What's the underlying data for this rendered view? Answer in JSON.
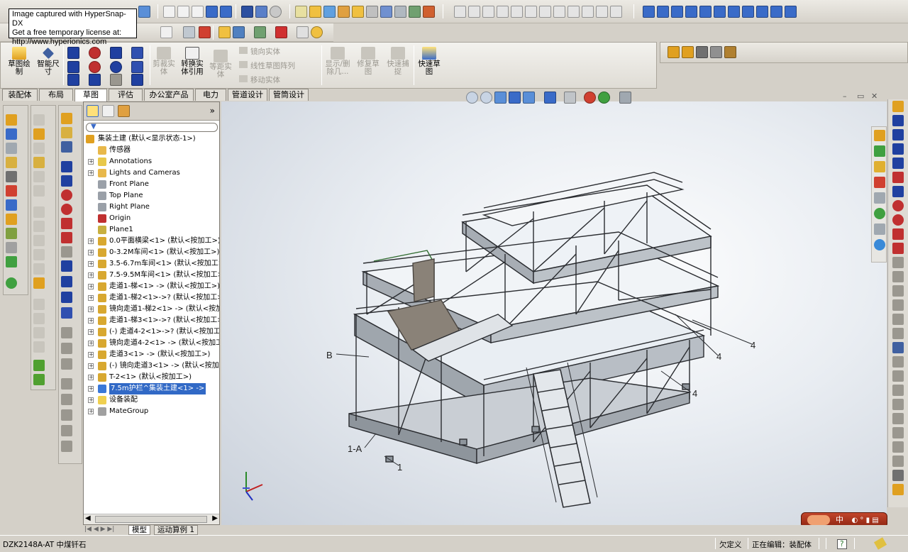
{
  "watermark": {
    "line1": "Image captured with HyperSnap-DX",
    "line2": "Get a free temporary license at:",
    "line3": "http://www.hyperionics.com"
  },
  "command_manager": {
    "sketch_btn": "草图绘制",
    "smart_dim_btn": "智能尺寸",
    "trim_btn": "剪裁实体",
    "convert_btn": "转换实体引用",
    "offset_btn": "等距实体",
    "mirror_entities": "镜向实体",
    "linear_pattern": "线性草图阵列",
    "move_entities": "移动实体",
    "show_delete_btn": "显示/删除几...",
    "repair_btn": "修复草图",
    "quick_snap_btn": "快速捕捉",
    "rapid_sketch_btn": "快速草图"
  },
  "tabs": [
    "装配体",
    "布局",
    "草图",
    "评估",
    "办公室产品",
    "电力",
    "管道设计",
    "管筒设计"
  ],
  "active_tab": "草图",
  "feature_tree": {
    "root": "集装土建 (默认<显示状态-1>)",
    "items": [
      {
        "label": "传感器",
        "expand": false,
        "color": "#e8b84a"
      },
      {
        "label": "Annotations",
        "expand": true,
        "color": "#e8c84a"
      },
      {
        "label": "Lights and Cameras",
        "expand": true,
        "color": "#e8b84a"
      },
      {
        "label": "Front Plane",
        "expand": false,
        "color": "#9aa0a8"
      },
      {
        "label": "Top Plane",
        "expand": false,
        "color": "#9aa0a8"
      },
      {
        "label": "Right Plane",
        "expand": false,
        "color": "#9aa0a8"
      },
      {
        "label": "Origin",
        "expand": false,
        "color": "#c03030"
      },
      {
        "label": "Plane1",
        "expand": false,
        "color": "#c8b040"
      },
      {
        "label": "0.0平面横梁<1> (默认<按加工>)",
        "expand": true,
        "color": "#d8a830"
      },
      {
        "label": "0-3.2M车间<1> (默认<按加工>)",
        "expand": true,
        "color": "#d8a830"
      },
      {
        "label": "3.5-6.7m车间<1> (默认<按加工>)",
        "expand": true,
        "color": "#d8a830"
      },
      {
        "label": "7.5-9.5M车间<1> (默认<按加工>)",
        "expand": true,
        "color": "#d8a830"
      },
      {
        "label": "走道1-梯<1> -> (默认<按加工>)",
        "expand": true,
        "color": "#d8a830"
      },
      {
        "label": "走道1-梯2<1>->? (默认<按加工>)",
        "expand": true,
        "color": "#d8a830"
      },
      {
        "label": "镜向走道1-梯2<1> -> (默认<按加工>)",
        "expand": true,
        "color": "#d8a830"
      },
      {
        "label": "走道1-梯3<1>->? (默认<按加工>)",
        "expand": true,
        "color": "#d8a830"
      },
      {
        "label": "(-) 走道4-2<1>->? (默认<按加工>)",
        "expand": true,
        "color": "#d8a830"
      },
      {
        "label": "镜向走道4-2<1> -> (默认<按加工>)",
        "expand": true,
        "color": "#d8a830"
      },
      {
        "label": "走道3<1> -> (默认<按加工>)",
        "expand": true,
        "color": "#d8a830"
      },
      {
        "label": "(-) 镜向走道3<1> -> (默认<按加工>)",
        "expand": true,
        "color": "#d8a830"
      },
      {
        "label": "T-2<1> (默认<按加工>)",
        "expand": true,
        "color": "#d8a830"
      },
      {
        "label": "7.5m护栏^集装土建<1> ->",
        "expand": true,
        "color": "#3a78d8",
        "selected": true
      },
      {
        "label": "设备装配",
        "expand": true,
        "color": "#f0d050"
      },
      {
        "label": "MateGroup",
        "expand": true,
        "color": "#a0a0a0"
      }
    ]
  },
  "callouts": {
    "b": "B",
    "four_1": "4",
    "four_2": "4",
    "four_3": "4",
    "one_a": "1-A",
    "one": "1"
  },
  "bottom_tabs": {
    "model": "模型",
    "motion": "运动算例 1"
  },
  "status": {
    "doc_name": "DZK2148A-AT 中煤钎石",
    "under_defined": "欠定义",
    "editing": "正在编辑：装配体",
    "help": "?"
  },
  "ime": {
    "label": "中"
  },
  "colors": {
    "selection": "#3169c6",
    "accent": "#d8a830",
    "ime": "#a8341a"
  }
}
